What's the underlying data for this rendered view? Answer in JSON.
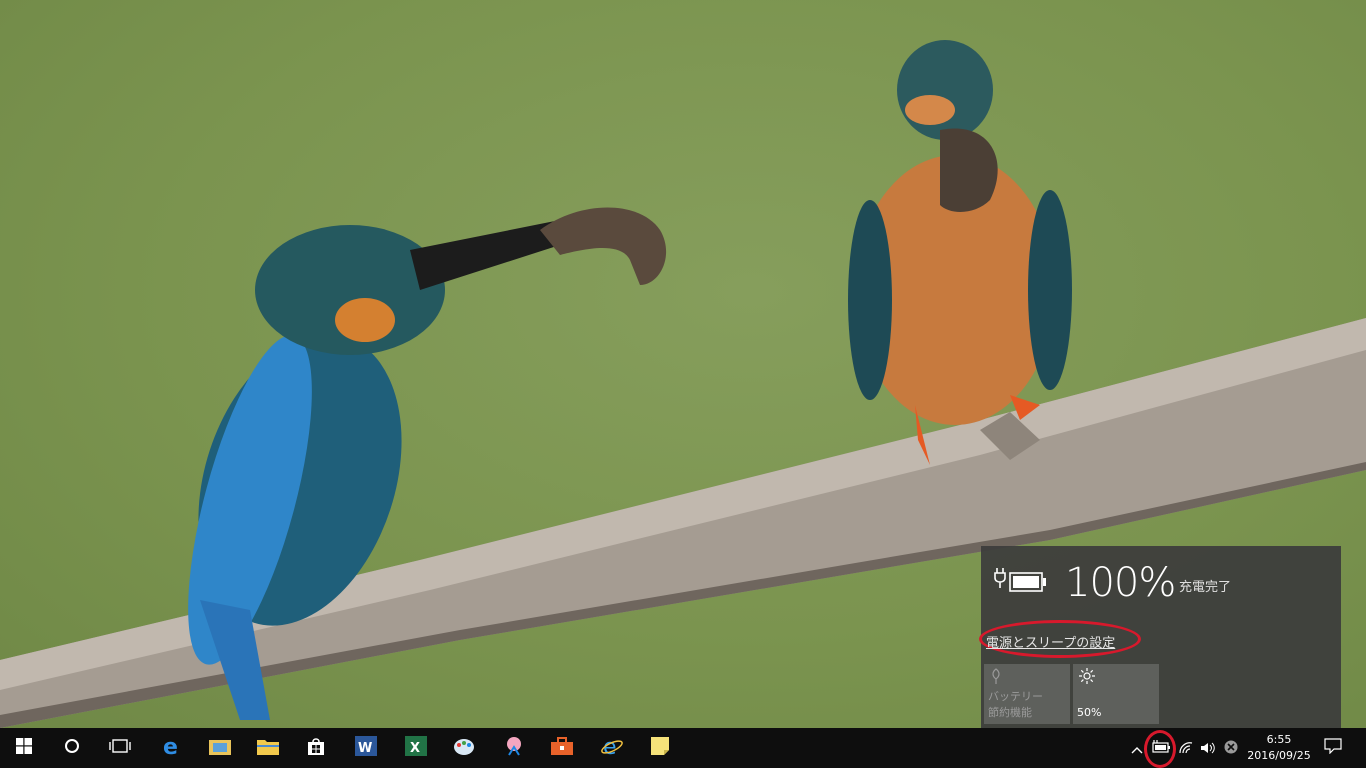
{
  "battery_flyout": {
    "percent": "100%",
    "status": "充電完了",
    "settings_link": "電源とスリープの設定",
    "quick_actions": [
      {
        "icon": "battery-saver-icon",
        "label_line1": "バッテリー",
        "label_line2": "節約機能"
      },
      {
        "icon": "brightness-icon",
        "label": "50%"
      }
    ]
  },
  "taskbar": {
    "pinned_apps": [
      "start-icon",
      "cortana-icon",
      "task-view-icon",
      "edge-icon",
      "explorer-photo-icon",
      "file-explorer-icon",
      "store-icon",
      "word-icon",
      "excel-icon",
      "paint-icon",
      "app-icon",
      "toolbox-icon",
      "internet-explorer-icon",
      "sticky-notes-icon"
    ],
    "clock": {
      "time": "6:55",
      "date": "2016/09/25"
    }
  },
  "colors": {
    "highlight": "#d8192c",
    "flyout_bg": "#3c3c3c",
    "taskbar_bg": "#0e0e0e",
    "wallpaper": "#7b944f"
  }
}
